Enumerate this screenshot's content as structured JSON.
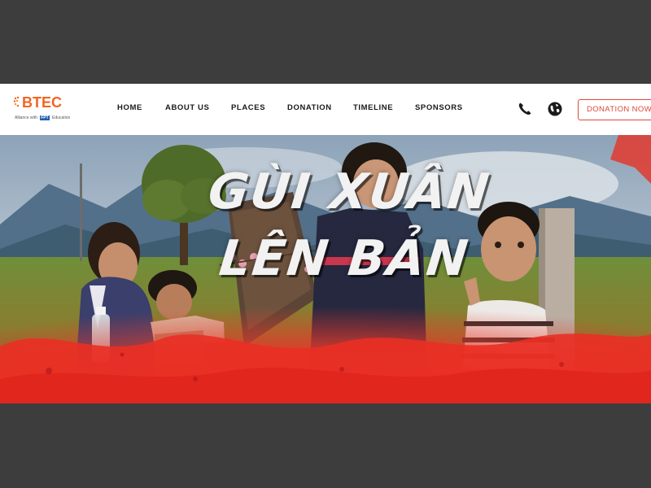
{
  "brand": {
    "name": "BTEC",
    "tagline_prefix": "Alliance with",
    "tagline_fpt": "FPT",
    "tagline_suffix": "Education",
    "color": "#f26522"
  },
  "nav": {
    "items": [
      {
        "label": "HOME"
      },
      {
        "label": "ABOUT US"
      },
      {
        "label": "PLACES"
      },
      {
        "label": "DONATION"
      },
      {
        "label": "TIMELINE"
      },
      {
        "label": "SPONSORS"
      }
    ]
  },
  "actions": {
    "phone_icon": "phone-icon",
    "globe_icon": "globe-icon",
    "donate_label": "DONATION NOW",
    "donate_color": "#e0473a"
  },
  "hero": {
    "title_line1": "GÙI XUÂN",
    "title_line2": "LÊN BẢN",
    "accent_color": "#e8322a"
  },
  "frame": {
    "background": "#3d3d3d"
  }
}
